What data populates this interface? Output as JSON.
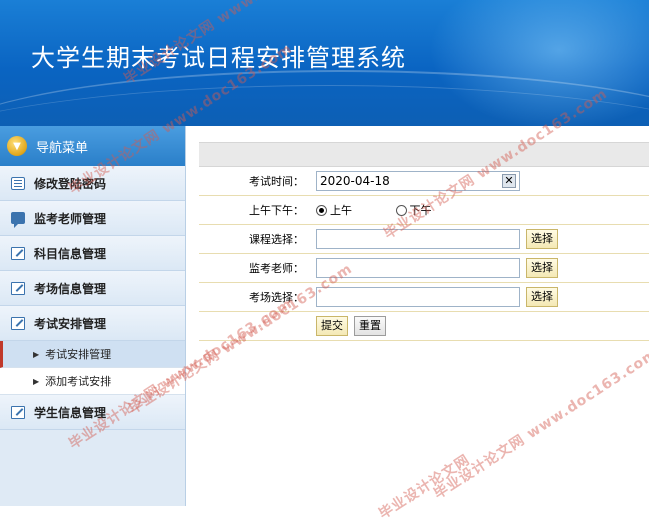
{
  "header": {
    "title": "大学生期末考试日程安排管理系统"
  },
  "sidebar": {
    "title": "导航菜单",
    "items": [
      {
        "label": "修改登陆密码",
        "icon": "list-icon"
      },
      {
        "label": "监考老师管理",
        "icon": "chat-icon"
      },
      {
        "label": "科目信息管理",
        "icon": "edit-icon"
      },
      {
        "label": "考场信息管理",
        "icon": "edit-icon"
      },
      {
        "label": "考试安排管理",
        "icon": "edit-icon"
      }
    ],
    "subitems": [
      {
        "label": "考试安排管理",
        "active": true
      },
      {
        "label": "添加考试安排",
        "active": false
      }
    ],
    "last_item": {
      "label": "学生信息管理",
      "icon": "edit-icon"
    }
  },
  "form": {
    "exam_time_label": "考试时间：",
    "exam_time_value": "2020-04-18",
    "period_label": "上午下午：",
    "period_am": "上午",
    "period_pm": "下午",
    "period_selected": "上午",
    "course_label": "课程选择：",
    "course_value": "",
    "teacher_label": "监考老师：",
    "teacher_value": "",
    "room_label": "考场选择：",
    "room_value": "",
    "select_button": "选择",
    "submit_button": "提交",
    "reset_button": "重置"
  },
  "watermarks": [
    "毕业设计论文网 www.doc163.com",
    "毕业设计论文网 www.doc163.com",
    "毕业设计论文网 www.doc163.com",
    "毕业设计论文网 www.doc163.com",
    "毕业设计论文网 www.doc163.com",
    "毕业设计论文网 www.doc163.com",
    "毕业设计论文网"
  ]
}
